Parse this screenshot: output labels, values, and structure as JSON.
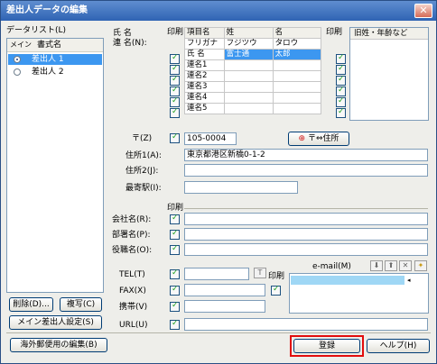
{
  "window": {
    "title": "差出人データの編集",
    "close_icon": "close-icon"
  },
  "datalist": {
    "label": "データリスト(L)",
    "col_main": "メイン",
    "col_name": "書式名",
    "items": [
      {
        "name": "差出人 1",
        "selected": true
      },
      {
        "name": "差出人 2",
        "selected": false
      }
    ],
    "delete_button": "削除(D)...",
    "copy_button": "複写(C)",
    "main_sender_button": "メイン差出人設定(S)"
  },
  "names": {
    "label_line1": "氏 名",
    "label_line2": "連 名(N):",
    "print_label": "印刷",
    "headers": [
      "項目名",
      "姓",
      "名"
    ],
    "rows": [
      {
        "label": "フリガナ",
        "sei": "フジツウ",
        "mei": "タロウ",
        "checked": false
      },
      {
        "label": "氏 名",
        "sei": "富士通",
        "mei": "太郎",
        "checked": true,
        "selected": true
      },
      {
        "label": "連名1",
        "sei": "",
        "mei": "",
        "checked": true
      },
      {
        "label": "連名2",
        "sei": "",
        "mei": "",
        "checked": true
      },
      {
        "label": "連名3",
        "sei": "",
        "mei": "",
        "checked": true
      },
      {
        "label": "連名4",
        "sei": "",
        "mei": "",
        "checked": true
      },
      {
        "label": "連名5",
        "sei": "",
        "mei": "",
        "checked": true
      }
    ],
    "print_label2": "印刷",
    "old_header": "旧姓・年齢など"
  },
  "address": {
    "zip_label": "〒(Z)",
    "zip_value": "105-0004",
    "zip_button": "〒⇔住所",
    "addr1_label": "住所1(A):",
    "addr1_value": "東京都港区新橋0-1-2",
    "addr2_label": "住所2(J):",
    "station_label": "最寄駅(I):"
  },
  "company": {
    "print_label": "印刷",
    "company_label": "会社名(R):",
    "dept_label": "部署名(P):",
    "title_label": "役職名(O):"
  },
  "contact": {
    "tel_label": "TEL(T)",
    "fax_label": "FAX(X)",
    "mobile_label": "携帯(V)",
    "url_label": "URL(U)",
    "print_label": "印刷",
    "email_label": "e-mail(M)"
  },
  "footer": {
    "overseas_button": "海外郵便用の編集(B)",
    "register_button": "登録",
    "help_button": "ヘルプ(H)"
  },
  "colors": {
    "accent": "#3c97f0",
    "highlight_border": "#e20d0d",
    "title_bar": "#2f63b3"
  }
}
